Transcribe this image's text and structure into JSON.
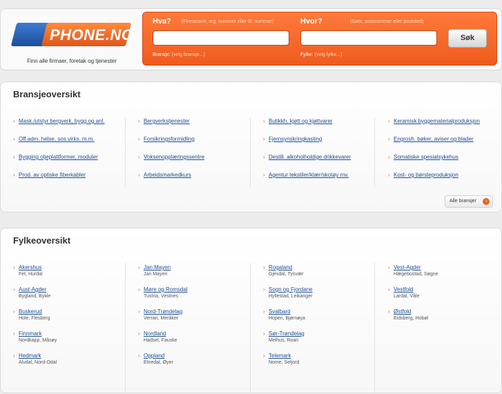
{
  "header": {
    "logo_text": "PHONE.NO",
    "tagline": "Finn alle firmaer, foretak og tjenester"
  },
  "search": {
    "what_label": "Hva?",
    "what_hint": "(Firmanavn, org. nummer eller tlf. nummer)",
    "where_label": "Hvor?",
    "where_hint": "(Gate, postnummer eller poststed)",
    "what_value": "",
    "where_value": "",
    "branch_label": "Bransje:",
    "branch_value": "(velg bransje...)",
    "county_label": "Fylke:",
    "county_value": "(velg fylke...)",
    "button": "Søk"
  },
  "branches": {
    "title": "Bransjeoversikt",
    "all_button": "Alle bransjer",
    "columns": [
      [
        "Mask./utstyr bergverk, bygg og anl.",
        "Off.adm. helse, sos.virks. m.m.",
        "Bygging oljeplattformer, moduler",
        "Prod. av optiske fiberkabler"
      ],
      [
        "Bergverkstjenester",
        "Forsikringsformidling",
        "Voksenopplæringssentre",
        "Arbeidsmarkedkurs"
      ],
      [
        "Butikkh. kjøtt og kjøttvarer",
        "Fjernsynskringkasting",
        "Destill. alkoholholdige drikkevarer",
        "Agentur tekstiler/klær/skotøy mv."
      ],
      [
        "Keramisk byggematerialproduksjon",
        "Engrosh. bøker, aviser og blader",
        "Somatiske spesialsykehus",
        "Kost- og børsteproduksjon"
      ]
    ]
  },
  "counties": {
    "title": "Fylkeoversikt",
    "columns": [
      [
        {
          "name": "Akershus",
          "towns": "Fet, Hurdal"
        },
        {
          "name": "Aust-Agder",
          "towns": "Bygland, Bykle"
        },
        {
          "name": "Buskerud",
          "towns": "Hole, Flesberg"
        },
        {
          "name": "Finnmark",
          "towns": "Nordkapp, Måsøy"
        },
        {
          "name": "Hedmark",
          "towns": "Alvdal, Nord-Odal"
        }
      ],
      [
        {
          "name": "Jan Mayen",
          "towns": "Jan Mayen"
        },
        {
          "name": "Møre og Romsdal",
          "towns": "Tustna, Vestnes"
        },
        {
          "name": "Nord-Trøndelag",
          "towns": "Verran, Meråker"
        },
        {
          "name": "Nordland",
          "towns": "Hadsel, Fauske"
        },
        {
          "name": "Oppland",
          "towns": "Etnedal, Øyer"
        }
      ],
      [
        {
          "name": "Rogaland",
          "towns": "Gjesdal, Tysvær"
        },
        {
          "name": "Sogn og Fjordane",
          "towns": "Hyllestad, Leikanger"
        },
        {
          "name": "Svalbard",
          "towns": "Hopen, Bjørnøya"
        },
        {
          "name": "Sør-Trøndelag",
          "towns": "Melhus, Roan"
        },
        {
          "name": "Telemark",
          "towns": "Nome, Seljord"
        }
      ],
      [
        {
          "name": "Vest-Agder",
          "towns": "Hægebostad, Søgne"
        },
        {
          "name": "Vestfold",
          "towns": "Lardal, Våle"
        },
        {
          "name": "Østfold",
          "towns": "Eidsberg, Hobøl"
        }
      ]
    ]
  }
}
